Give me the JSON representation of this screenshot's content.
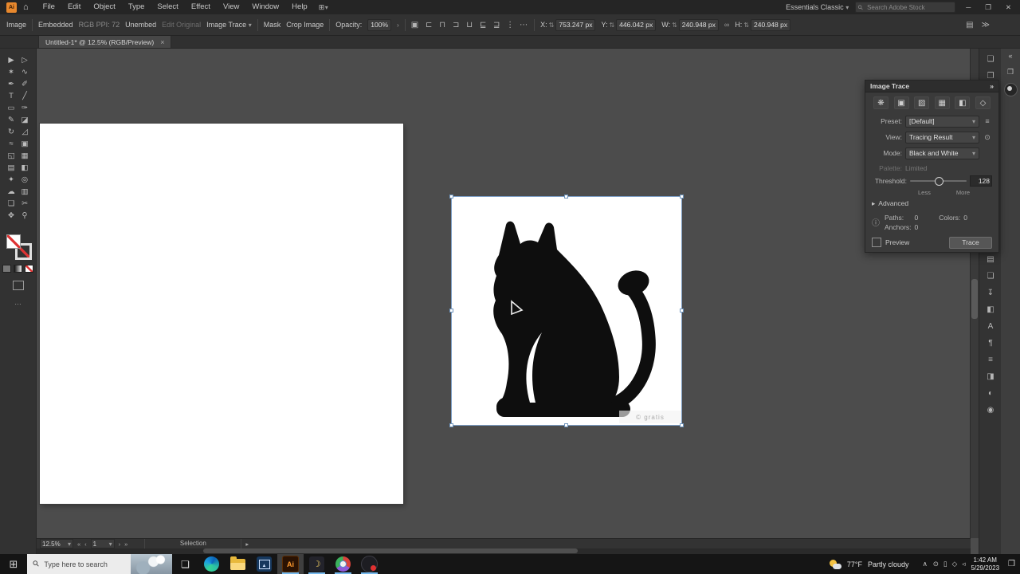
{
  "app": {
    "logo_text": "Ai",
    "workspace": "Essentials Classic",
    "search_placeholder": "Search Adobe Stock",
    "grid_icon_glyph": "⊞",
    "grid_caret_glyph": "▾",
    "home_glyph": "⌂"
  },
  "menu": {
    "items": [
      "File",
      "Edit",
      "Object",
      "Type",
      "Select",
      "Effect",
      "View",
      "Window",
      "Help"
    ]
  },
  "window_controls": {
    "minimize": "─",
    "restore": "❐",
    "close": "✕"
  },
  "control_bar": {
    "selection_type": "Image",
    "embedded_label": "Embedded",
    "image_meta": "RGB PPI: 72",
    "unembed_label": "Unembed",
    "edit_original_label": "Edit Original",
    "image_trace_label": "Image Trace",
    "mask_label": "Mask",
    "crop_image_label": "Crop Image",
    "opacity_label": "Opacity:",
    "opacity_value": "100%",
    "opacity_chevron": "›",
    "dropdown_glyph": "▾",
    "style_icon_glyph": "▣",
    "stepper_glyph": "⇅",
    "link_icon_glyph": "∞",
    "align_icons": [
      {
        "name": "align-left-icon",
        "glyph": "⊏"
      },
      {
        "name": "align-center-h-icon",
        "glyph": "⊓"
      },
      {
        "name": "align-right-icon",
        "glyph": "⊐"
      },
      {
        "name": "align-top-icon",
        "glyph": "⊔"
      },
      {
        "name": "align-middle-icon",
        "glyph": "⊑"
      },
      {
        "name": "align-bottom-icon",
        "glyph": "⊒"
      },
      {
        "name": "distribute-vertical-icon",
        "glyph": "⋮"
      },
      {
        "name": "distribute-horizontal-icon",
        "glyph": "⋯"
      }
    ],
    "transform_fields": [
      {
        "label": "X:",
        "value": "753.247 px"
      },
      {
        "label": "Y:",
        "value": "446.042 px"
      },
      {
        "label": "W:",
        "value": "240.948 px"
      },
      {
        "label": "H:",
        "value": "240.948 px"
      }
    ],
    "right_icons": [
      {
        "name": "panel-dock-icon",
        "glyph": "▤"
      },
      {
        "name": "collapse-control-icon",
        "glyph": "≫"
      }
    ]
  },
  "document_tab": {
    "title": "Untitled-1* @ 12.5% (RGB/Preview)",
    "close_glyph": "×"
  },
  "tools": [
    {
      "name": "selection-tool",
      "glyph": "▶"
    },
    {
      "name": "direct-selection-tool",
      "glyph": "▷"
    },
    {
      "name": "magic-wand-tool",
      "glyph": "✶"
    },
    {
      "name": "lasso-tool",
      "glyph": "∿"
    },
    {
      "name": "pen-tool",
      "glyph": "✒"
    },
    {
      "name": "curvature-tool",
      "glyph": "✐"
    },
    {
      "name": "type-tool",
      "glyph": "T"
    },
    {
      "name": "line-segment-tool",
      "glyph": "╱"
    },
    {
      "name": "rectangle-tool",
      "glyph": "▭"
    },
    {
      "name": "paintbrush-tool",
      "glyph": "✑"
    },
    {
      "name": "pencil-tool",
      "glyph": "✎"
    },
    {
      "name": "eraser-tool",
      "glyph": "◪"
    },
    {
      "name": "rotate-tool",
      "glyph": "↻"
    },
    {
      "name": "scale-tool",
      "glyph": "◿"
    },
    {
      "name": "width-tool",
      "glyph": "≈"
    },
    {
      "name": "free-transform-tool",
      "glyph": "▣"
    },
    {
      "name": "shape-builder-tool",
      "glyph": "◱"
    },
    {
      "name": "perspective-grid-tool",
      "glyph": "▦"
    },
    {
      "name": "mesh-tool",
      "glyph": "▤"
    },
    {
      "name": "gradient-tool",
      "glyph": "◧"
    },
    {
      "name": "eyedropper-tool",
      "glyph": "✦"
    },
    {
      "name": "blend-tool",
      "glyph": "◎"
    },
    {
      "name": "symbol-sprayer-tool",
      "glyph": "☁"
    },
    {
      "name": "column-graph-tool",
      "glyph": "▥"
    },
    {
      "name": "artboard-tool",
      "glyph": "❏"
    },
    {
      "name": "slice-tool",
      "glyph": "✂"
    },
    {
      "name": "hand-tool",
      "glyph": "✥"
    },
    {
      "name": "zoom-tool",
      "glyph": "⚲"
    }
  ],
  "trace_panel": {
    "title": "Image Trace",
    "collapse_glyph": "»",
    "presets": [
      {
        "name": "preset-auto-color-icon",
        "glyph": "❋"
      },
      {
        "name": "preset-high-color-icon",
        "glyph": "▣"
      },
      {
        "name": "preset-low-color-icon",
        "glyph": "▨"
      },
      {
        "name": "preset-grayscale-icon",
        "glyph": "▦"
      },
      {
        "name": "preset-black-white-icon",
        "glyph": "◧"
      },
      {
        "name": "preset-outline-icon",
        "glyph": "◇"
      }
    ],
    "preset_label": "Preset:",
    "preset_value": "[Default]",
    "preset_menu_glyph": "≡",
    "view_label": "View:",
    "view_value": "Tracing Result",
    "view_eye_glyph": "⊙",
    "mode_label": "Mode:",
    "mode_value": "Black and White",
    "palette_label": "Palette:",
    "palette_value": "Limited",
    "threshold_label": "Threshold:",
    "threshold_value": "128",
    "less_label": "Less",
    "more_label": "More",
    "advanced_toggle_glyph": "▸",
    "advanced_label": "Advanced",
    "info_glyph": "ⓘ",
    "paths_label": "Paths:",
    "paths_value": "0",
    "anchors_label": "Anchors:",
    "anchors_value": "0",
    "colors_label": "Colors:",
    "colors_value": "0",
    "preview_label": "Preview",
    "trace_button_label": "Trace",
    "dropdown_glyph": "▾"
  },
  "right_dock": {
    "top_icons": [
      {
        "name": "libraries-panel-icon",
        "glyph": "❏"
      },
      {
        "name": "links-panel-icon",
        "glyph": "❐"
      }
    ],
    "panel_icons": [
      {
        "name": "layers-panel-icon",
        "glyph": "▤"
      },
      {
        "name": "artboards-panel-icon",
        "glyph": "❏"
      },
      {
        "name": "asset-export-panel-icon",
        "glyph": "↧"
      },
      {
        "name": "color-panel-icon",
        "glyph": "◧"
      },
      {
        "name": "character-panel-icon",
        "glyph": "A"
      },
      {
        "name": "paragraph-panel-icon",
        "glyph": "¶"
      },
      {
        "name": "stroke-panel-icon",
        "glyph": "≡"
      },
      {
        "name": "gradient-panel-icon",
        "glyph": "◨"
      },
      {
        "name": "transparency-panel-icon",
        "glyph": "◐"
      },
      {
        "name": "appearance-panel-icon",
        "glyph": "◉"
      }
    ],
    "strip_icons": [
      {
        "name": "expand-panels-icon",
        "glyph": "«"
      },
      {
        "name": "properties-panel-icon",
        "glyph": "❐"
      }
    ]
  },
  "status_bar": {
    "zoom_value": "12.5%",
    "dropdown_glyph": "▾",
    "nav": {
      "first": "«",
      "prev": "‹",
      "artboard": "1",
      "next": "›",
      "last": "»"
    },
    "tool_label": "Selection",
    "submenu_glyph": "▸"
  },
  "artboard_image": {
    "watermark": "© gratis"
  },
  "taskbar": {
    "start_glyph": "⊞",
    "search_placeholder": "Type here to search",
    "task_view_glyph": "❏",
    "illustrator_badge": "Ai",
    "photos_glyph": "▲",
    "night_glyph": "☽",
    "weather": {
      "temp": "77°F",
      "desc": "Partly cloudy"
    },
    "hidden_icons_glyph": "∧",
    "tray_icons": [
      {
        "name": "tray-app-1-icon",
        "glyph": "⊙"
      },
      {
        "name": "tray-app-2-icon",
        "glyph": "▯"
      },
      {
        "name": "tray-app-3-icon",
        "glyph": "◇"
      },
      {
        "name": "tray-app-4-icon",
        "glyph": "◃"
      }
    ],
    "clock": {
      "time": "1:42 AM",
      "date": "5/29/2023"
    },
    "notification_glyph": "❒"
  },
  "colors": {
    "selection_outline": "#7d9fc6",
    "taskbar_active_underline": "#76b9ed",
    "canvas": "#4c4c4c",
    "artboard": "#ffffff",
    "panel_bg": "#3a3a3a",
    "taskbar_bg": "#151515",
    "ai_logo_orange": "#e8882d"
  }
}
